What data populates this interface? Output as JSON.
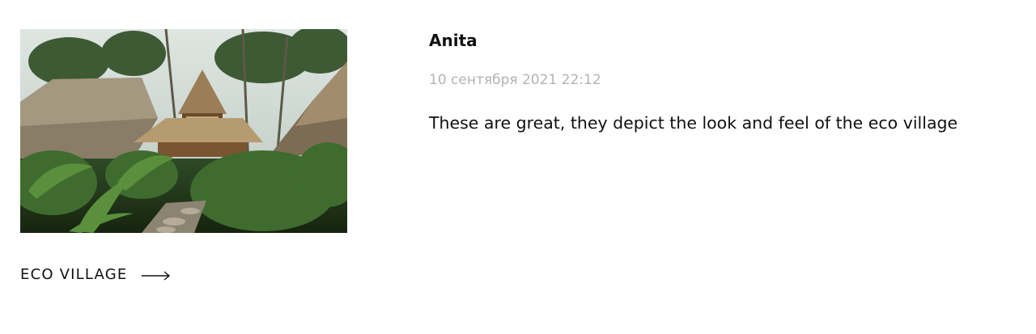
{
  "project": {
    "image_alt": "Eco village thatched bungalows among tropical greenery",
    "link_label": "ECO VILLAGE",
    "arrow_icon": "arrow-right-icon"
  },
  "review": {
    "author": "Anita",
    "date": "10 сентября 2021 22:12",
    "text": "These are great, they depict the look and feel of the eco village"
  },
  "colors": {
    "text": "#111111",
    "date": "#b3b3b3",
    "background": "#ffffff"
  }
}
